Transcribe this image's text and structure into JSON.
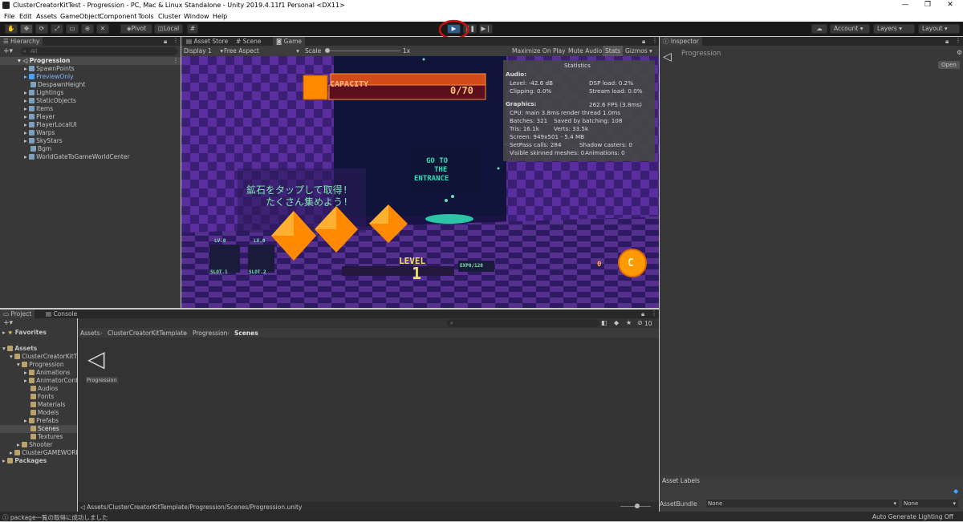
{
  "window": {
    "title": "ClusterCreatorKitTest - Progression - PC, Mac & Linux Standalone - Unity 2019.4.11f1 Personal <DX11>",
    "minimize": "—",
    "maximize": "❐",
    "close": "✕"
  },
  "menu": [
    "File",
    "Edit",
    "Assets",
    "GameObject",
    "Component",
    "Tools",
    "Cluster",
    "Window",
    "Help"
  ],
  "toolbar": {
    "pivot": "Pivot",
    "local": "Local",
    "account": "Account",
    "layers": "Layers",
    "layout": "Layout"
  },
  "hierarchy": {
    "tab": "Hierarchy",
    "search_placeholder": "All",
    "scene": "Progression",
    "items": [
      "SpawnPoints",
      "PreviewOnly",
      "DespawnHeight",
      "Lightings",
      "StaticObjects",
      "Items",
      "Player",
      "PlayerLocalUI",
      "Warps",
      "SkyStars",
      "Bgm",
      "WorldGateToGameWorldCenter"
    ]
  },
  "game_tabs": [
    "Asset Store",
    "Scene",
    "Game"
  ],
  "game_bar": {
    "display": "Display 1",
    "aspect": "Free Aspect",
    "scale_label": "Scale",
    "scale_value": "1x",
    "maximize": "Maximize On Play",
    "mute": "Mute Audio",
    "stats": "Stats",
    "gizmos": "Gizmos"
  },
  "stats": {
    "title": "Statistics",
    "audio_head": "Audio:",
    "level": "Level: -42.6 dB",
    "clipping": "Clipping: 0.0%",
    "dsp": "DSP load: 0.2%",
    "stream": "Stream load: 0.0%",
    "graphics_head": "Graphics:",
    "fps": "262.6 FPS (3.8ms)",
    "cpu": "CPU: main 3.8ms  render thread 1.0ms",
    "batches": "Batches: 321",
    "saved": "Saved by batching: 108",
    "tris": "Tris: 16.1k",
    "verts": "Verts: 33.5k",
    "screen": "Screen: 949x501 - 5.4 MB",
    "setpass": "SetPass calls: 284",
    "shadow": "Shadow casters: 0",
    "skinned": "Visible skinned meshes: 0",
    "anims": "Animations: 0"
  },
  "game_view": {
    "capacity": "CAPACITY",
    "capacity_value": "0/70",
    "goto": [
      "GO TO",
      "THE",
      "ENTRANCE"
    ],
    "jp_line1": "鉱石をタップして取得!",
    "jp_line2": "たくさん集めよう!",
    "slot1_lv": "LV.0",
    "slot2_lv": "LV.0",
    "slot1": "SLOT.1",
    "slot2": "SLOT.2",
    "level_label": "LEVEL",
    "level_value": "1",
    "exp": "EXP0/120",
    "coins": "0"
  },
  "inspector": {
    "tab": "Inspector",
    "object": "Progression",
    "open": "Open",
    "asset_labels": "Asset Labels",
    "asset_bundle": "AssetBundle",
    "bundle_value": "None",
    "variant_value": "None"
  },
  "project": {
    "tabs": [
      "Project",
      "Console"
    ],
    "favorites": "Favorites",
    "assets": "Assets",
    "tree": [
      "ClusterCreatorKitT",
      "Progression",
      "Animations",
      "AnimatorCont",
      "Audios",
      "Fonts",
      "Materials",
      "Models",
      "Prefabs",
      "Scenes",
      "Textures",
      "Shooter",
      "ClusterGAMEWORI"
    ],
    "packages": "Packages",
    "breadcrumb": [
      "Assets",
      "ClusterCreatorKitTemplate",
      "Progression",
      "Scenes"
    ],
    "asset_name": "Progression",
    "path": "Assets/ClusterCreatorKitTemplate/Progression/Scenes/Progression.unity",
    "count": "10"
  },
  "status": {
    "message": "package一覧の取得に成功しました",
    "lighting": "Auto Generate Lighting Off"
  },
  "colors": {
    "play_highlight": "#2d5d8c",
    "annotation_circle": "#cc1111",
    "game_bg": "#2a1a57",
    "ore": "#ff8a00",
    "green_text": "#7fe8b0"
  }
}
